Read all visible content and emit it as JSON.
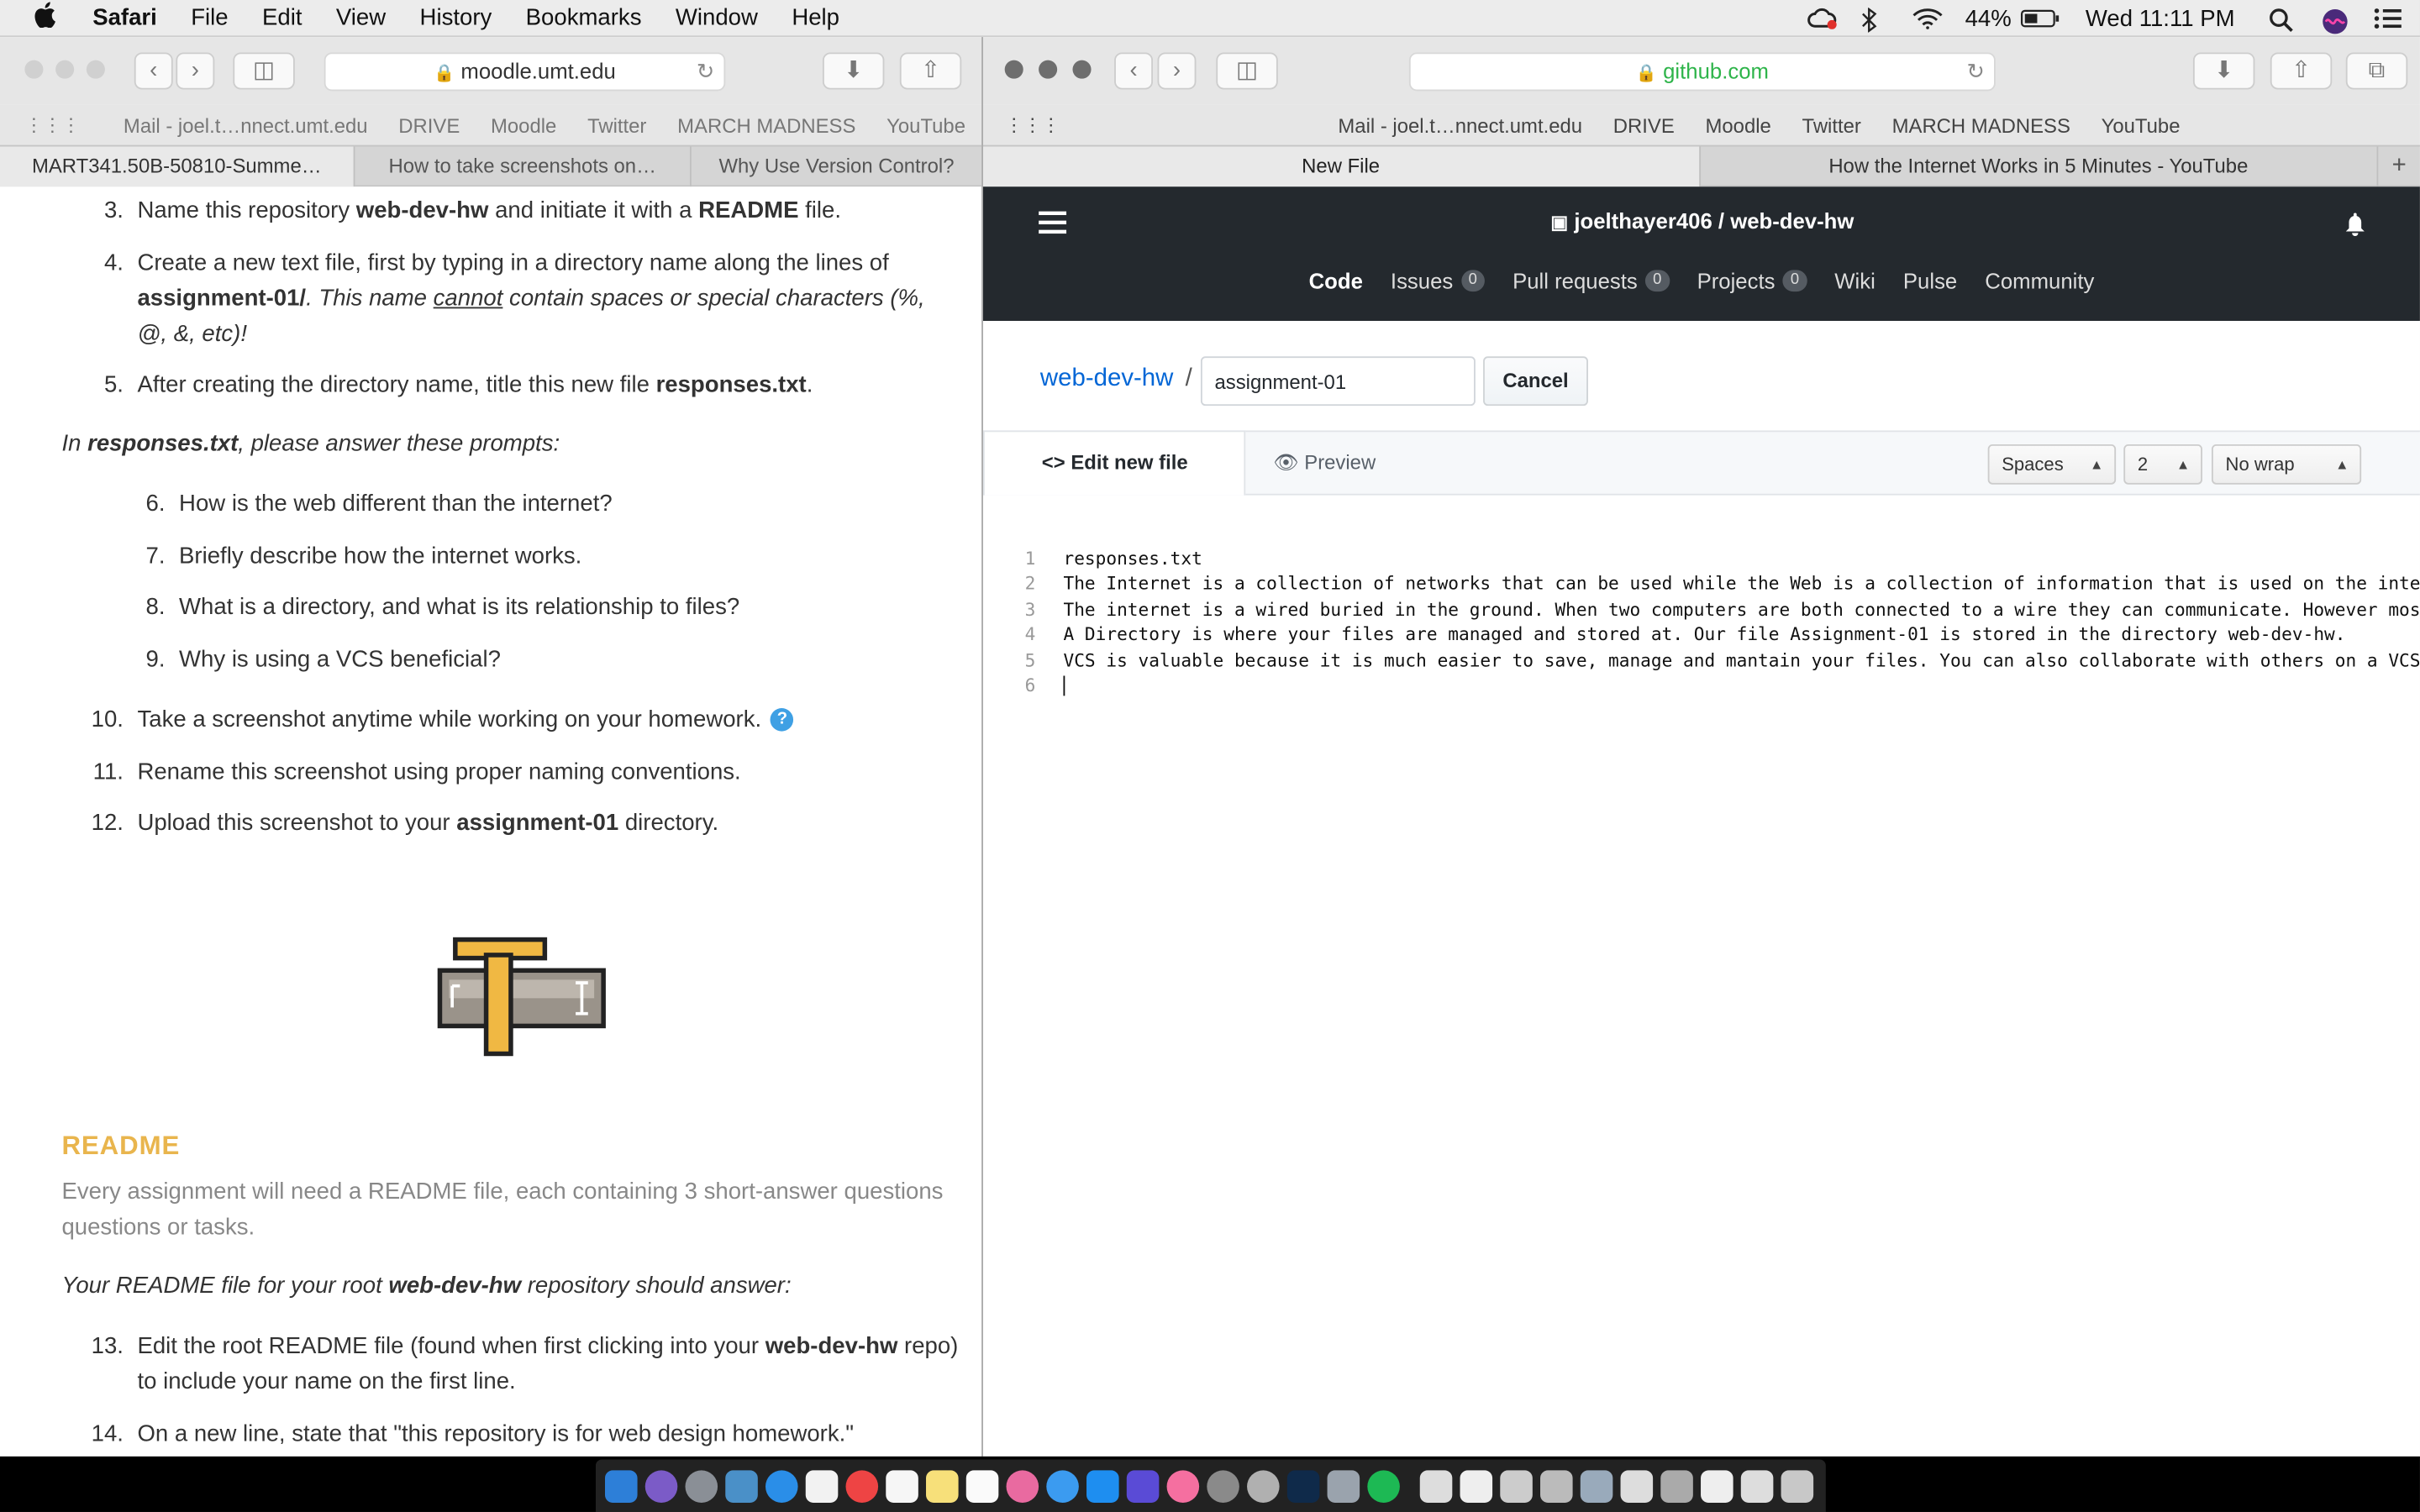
{
  "menubar": {
    "app": "Safari",
    "items": [
      "File",
      "Edit",
      "View",
      "History",
      "Bookmarks",
      "Window",
      "Help"
    ],
    "battery": "44%",
    "clock": "Wed 11:11 PM"
  },
  "left_window": {
    "url": "moodle.umt.edu",
    "bookmarks": [
      "Mail - joel.t…nnect.umt.edu",
      "DRIVE",
      "Moodle",
      "Twitter",
      "MARCH MADNESS",
      "YouTube"
    ],
    "tabs": [
      "MART341.50B-50810-Summe…",
      "How to take screenshots on…",
      "Why Use Version Control?"
    ],
    "content": {
      "item3": {
        "num": "3.",
        "pre": "Name this repository ",
        "b1": "web-dev-hw",
        "mid": " and initiate it with a ",
        "b2": "README",
        "post": " file."
      },
      "item4": {
        "num": "4.",
        "line1": "Create a new text file, first by typing in a directory name along the lines of",
        "b1": "assignment-01/",
        "i1": ". This name ",
        "u1": "cannot",
        "i2": " contain spaces or special characters (%,",
        "line3": "@, &, etc)!"
      },
      "item5": {
        "num": "5.",
        "pre": "After creating the directory name, title this new file ",
        "b1": "responses.txt",
        "post": "."
      },
      "intro": {
        "pre": "In ",
        "b1": "responses.txt",
        "post": ", please answer these prompts:"
      },
      "prompts": [
        {
          "num": "6.",
          "text": "How is the web different than the internet?"
        },
        {
          "num": "7.",
          "text": "Briefly describe how the internet works."
        },
        {
          "num": "8.",
          "text": "What is a directory, and what is its relationship to files?"
        },
        {
          "num": "9.",
          "text": "Why is using a VCS beneficial?"
        }
      ],
      "item10": {
        "num": "10.",
        "text": "Take a screenshot anytime while working on your homework.",
        "help": "?"
      },
      "item11": {
        "num": "11.",
        "text": "Rename this screenshot using proper naming conventions."
      },
      "item12": {
        "num": "12.",
        "pre": "Upload this screenshot to your ",
        "b1": "assignment-01",
        "post": " directory."
      },
      "readme_heading": "README",
      "readme_desc": "Every assignment will need a README file, each containing 3 short-answer questions questions or tasks.",
      "readme_intro": {
        "pre": "Your README file for your root ",
        "b1": "web-dev-hw",
        "post": " repository should answer:"
      },
      "item13": {
        "num": "13.",
        "pre": "Edit the root README file (found when first clicking into your ",
        "b1": "web-dev-hw",
        "post": " repo)",
        "line2": "to include your name on the first line."
      },
      "item14": {
        "num": "14.",
        "text": "On a new line, state that \"this repository is for web design homework.\""
      }
    }
  },
  "right_window": {
    "url": "github.com",
    "bookmarks": [
      "Mail - joel.t…nnect.umt.edu",
      "DRIVE",
      "Moodle",
      "Twitter",
      "MARCH MADNESS",
      "YouTube"
    ],
    "tabs": [
      "New File",
      "How the Internet Works in 5 Minutes - YouTube"
    ],
    "repo_owner": "joelthayer406",
    "repo_sep": " / ",
    "repo_name": "web-dev-hw",
    "nav": [
      {
        "label": "Code",
        "count": null
      },
      {
        "label": "Issues",
        "count": "0"
      },
      {
        "label": "Pull requests",
        "count": "0"
      },
      {
        "label": "Projects",
        "count": "0"
      },
      {
        "label": "Wiki",
        "count": null
      },
      {
        "label": "Pulse",
        "count": null
      },
      {
        "label": "Community",
        "count": null
      }
    ],
    "breadcrumb_repo": "web-dev-hw",
    "breadcrumb_sep": "/",
    "filename_value": "assignment-01",
    "cancel_label": "Cancel",
    "edit_tab": "Edit new file",
    "preview_tab": "Preview",
    "indent_mode": "Spaces",
    "indent_size": "2",
    "wrap_mode": "No wrap",
    "code_lines": [
      {
        "n": "1",
        "t": "responses.txt"
      },
      {
        "n": "2",
        "t": "The Internet is a collection of networks that can be used while the Web is a collection of information that is used on the internet."
      },
      {
        "n": "3",
        "t": "The internet is a wired buried in the ground. When two computers are both connected to a wire they can communicate. However most compu"
      },
      {
        "n": "4",
        "t": "A Directory is where your files are managed and stored at. Our file Assignment-01 is stored in the directory web-dev-hw."
      },
      {
        "n": "5",
        "t": "VCS is valuable because it is much easier to save, manage and mantain your files. You can also collaborate with others on a VCS."
      },
      {
        "n": "6",
        "t": ""
      }
    ]
  },
  "colors": {
    "accent_link": "#0366d6",
    "readme_gold": "#e9b54d",
    "github_header": "#24292e",
    "ssl_green": "#2eb44a"
  }
}
